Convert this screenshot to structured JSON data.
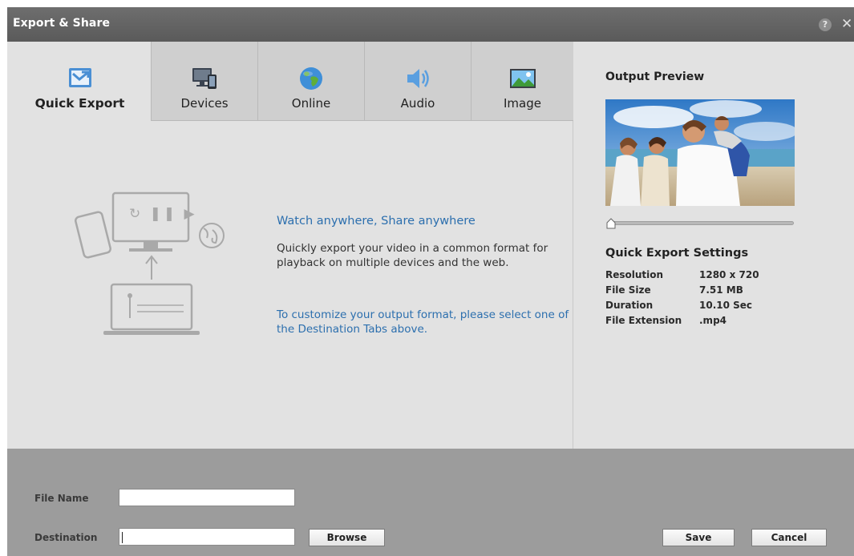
{
  "window": {
    "title": "Export & Share",
    "help_glyph": "?",
    "close_glyph": "✕"
  },
  "tabs": [
    {
      "label": "Quick Export",
      "icon": "quick-export-icon",
      "active": true
    },
    {
      "label": "Devices",
      "icon": "devices-icon",
      "active": false
    },
    {
      "label": "Online",
      "icon": "globe-icon",
      "active": false
    },
    {
      "label": "Audio",
      "icon": "speaker-icon",
      "active": false
    },
    {
      "label": "Image",
      "icon": "image-icon",
      "active": false
    }
  ],
  "main": {
    "heading": "Watch anywhere, Share anywhere",
    "body": "Quickly export your video in a common format for playback on multiple devices and the web.",
    "hint": "To customize your output format, please select one of the Destination Tabs above.",
    "illustration_playback_glyphs": "↻ ❚❚ ▶"
  },
  "preview": {
    "title": "Output Preview",
    "slider_position": 0
  },
  "settings": {
    "title": "Quick Export Settings",
    "rows": [
      {
        "key": "Resolution",
        "value": "1280 x 720"
      },
      {
        "key": "File Size",
        "value": "7.51 MB"
      },
      {
        "key": "Duration",
        "value": "10.10 Sec"
      },
      {
        "key": "File Extension",
        "value": ".mp4"
      }
    ]
  },
  "footer": {
    "file_name_label": "File Name",
    "file_name_value": "",
    "destination_label": "Destination",
    "destination_value": "",
    "browse_label": "Browse",
    "save_label": "Save",
    "cancel_label": "Cancel"
  },
  "colors": {
    "accent_blue": "#2c6fae",
    "titlebar": "#5f5f5f",
    "footer": "#9c9c9c",
    "pane": "#e2e2e2"
  }
}
